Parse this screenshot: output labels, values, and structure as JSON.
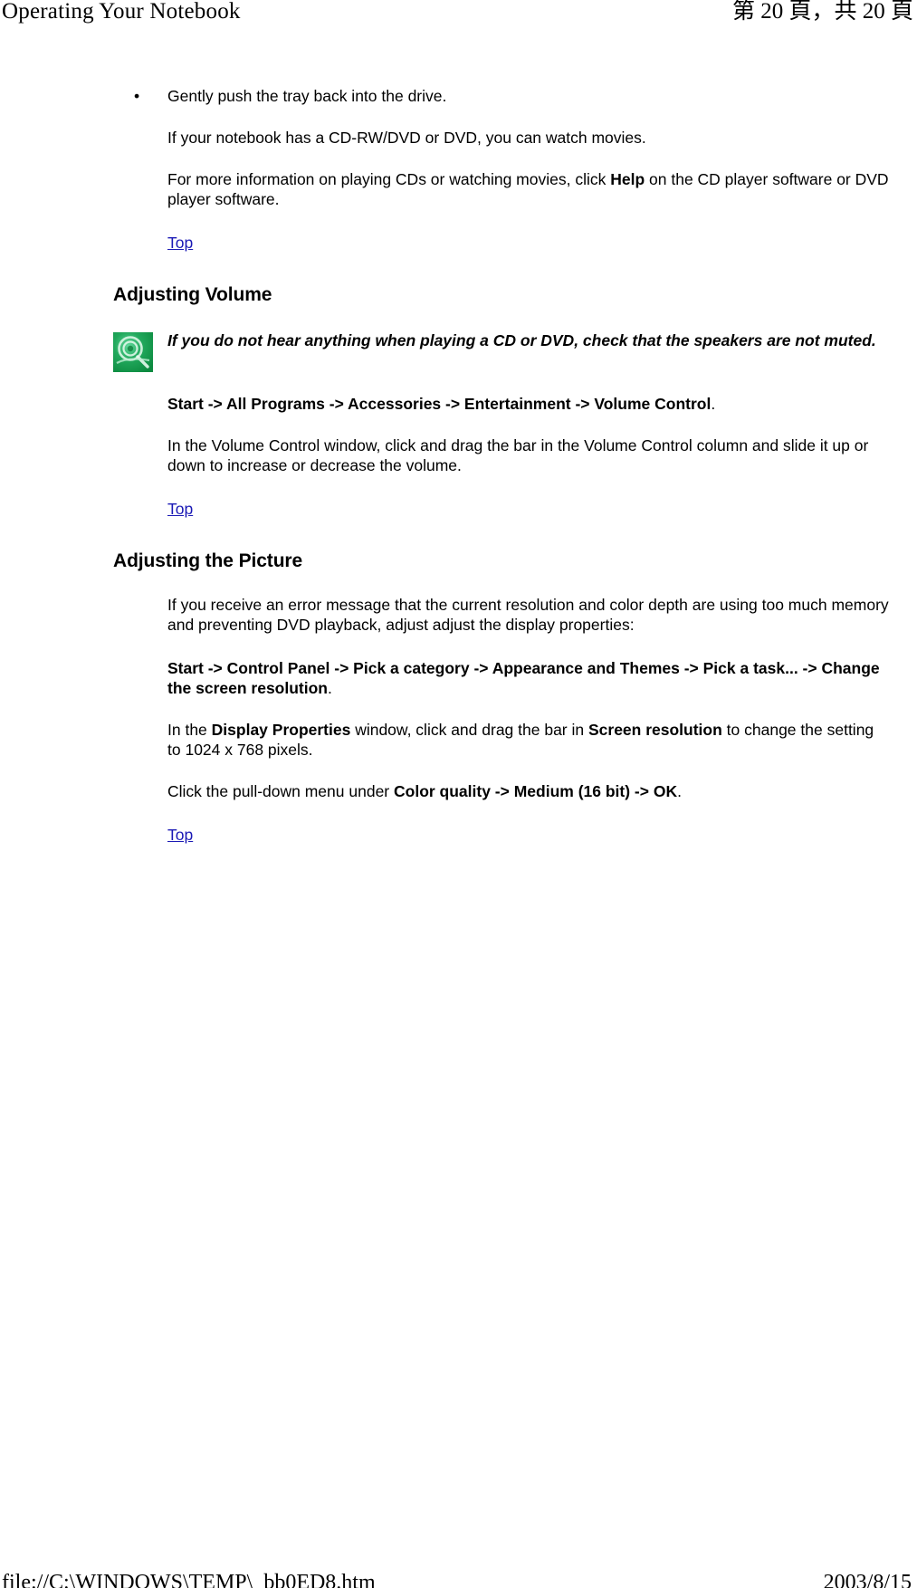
{
  "print_header": {
    "title": "Operating Your Notebook",
    "page_indicator": "第 20 頁，共 20 頁"
  },
  "print_footer": {
    "file_path": "file://C:\\WINDOWS\\TEMP\\_bb0ED8.htm",
    "date": "2003/8/15"
  },
  "links": {
    "top_label": "Top"
  },
  "icons": {
    "note_icon_name": "green-disc-note-icon",
    "bullet_glyph": "•"
  },
  "colors": {
    "link": "#1a19b5",
    "note_icon_green": "#119944",
    "text": "#000000",
    "background": "#ffffff"
  },
  "content": {
    "bullet_item": "Gently push the tray back into the drive.",
    "para_watch_movies": "If your notebook has a CD-RW/DVD or DVD, you can watch movies.",
    "para_more_info_pre": "For more information on playing CDs or watching movies, click ",
    "para_more_info_bold": "Help",
    "para_more_info_post": " on the CD player software or DVD player software.",
    "heading_adjusting_volume": "Adjusting Volume",
    "note_volume": "If you do not hear anything when playing a CD or DVD, check that the speakers are not muted.",
    "path_volume_bold": "Start -> All Programs -> Accessories -> Entertainment -> Volume Control",
    "path_volume_period": ".",
    "para_volume_control": "In the Volume Control window, click and drag the bar in the Volume Control column and slide it up or down to increase or decrease the volume.",
    "heading_adjusting_picture": "Adjusting the Picture",
    "para_error_message": "If you receive an error message that the current resolution and color depth are using too much memory and preventing DVD playback, adjust adjust the display properties:",
    "path_display_bold": "Start -> Control Panel -> Pick a category -> Appearance and Themes -> Pick a task... -> Change the screen resolution",
    "path_display_period": ".",
    "para_display_pre": "In the ",
    "para_display_b1": "Display Properties",
    "para_display_mid": " window, click and drag the bar in ",
    "para_display_b2": "Screen resolution",
    "para_display_post": " to change the setting to 1024 x 768 pixels.",
    "para_color_pre": "Click the pull-down menu under ",
    "para_color_b1": "Color quality -> Medium (16 bit) -> OK",
    "para_color_post": "."
  }
}
